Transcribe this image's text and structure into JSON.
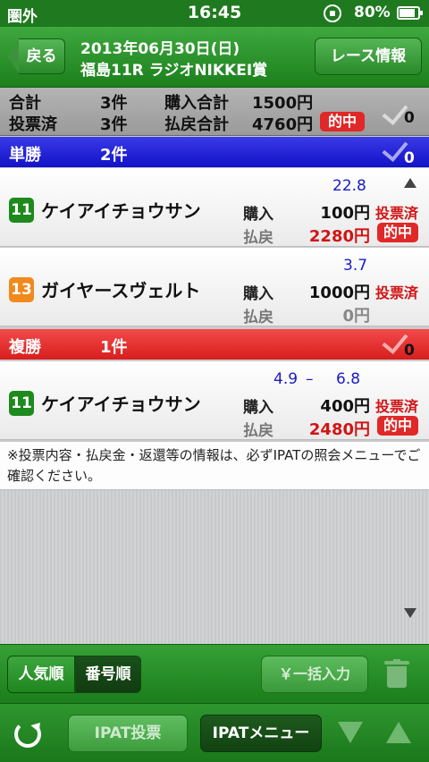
{
  "status_bar": {
    "carrier": "圏外",
    "time": "16:45",
    "battery": "80%"
  },
  "nav": {
    "back_label": "戻る",
    "date": "2013年06月30日(日)",
    "race": "福島11R ラジオNIKKEI賞",
    "race_info_label": "レース情報"
  },
  "summary": {
    "total_label": "合計",
    "total_count": "3件",
    "purchase_label": "購入合計",
    "purchase_amount": "1500円",
    "voted_label": "投票済",
    "voted_count": "3件",
    "payout_label": "払戻合計",
    "payout_amount": "4760円",
    "hit_badge": "的中",
    "checked_count": "0"
  },
  "sections": [
    {
      "name": "単勝",
      "count": "2件",
      "checked_count": "0",
      "color": "#1a1ad6"
    },
    {
      "name": "複勝",
      "count": "1件",
      "checked_count": "0",
      "color": "#e02a2a"
    }
  ],
  "bets": [
    {
      "number": "11",
      "number_color": "#1e8a1e",
      "horse": "ケイアイチョウサン",
      "odds": "22.8",
      "buy_label": "購入",
      "buy_amount": "100円",
      "status": "投票済",
      "payout_label": "払戻",
      "payout_amount": "2280円",
      "hit": "的中"
    },
    {
      "number": "13",
      "number_color": "#f08a1c",
      "horse": "ガイヤースヴェルト",
      "odds": "3.7",
      "buy_label": "購入",
      "buy_amount": "1000円",
      "status": "投票済",
      "payout_label": "払戻",
      "payout_amount": "0円"
    },
    {
      "number": "11",
      "number_color": "#1e8a1e",
      "horse": "ケイアイチョウサン",
      "odds_low": "4.9",
      "odds_sep": "–",
      "odds_high": "6.8",
      "buy_label": "購入",
      "buy_amount": "400円",
      "status": "投票済",
      "payout_label": "払戻",
      "payout_amount": "2480円",
      "hit": "的中"
    }
  ],
  "notice": "※投票内容・払戻金・返還等の情報は、必ずIPATの照会メニューでご確認ください。",
  "toolbar": {
    "sort_popular": "人気順",
    "sort_number": "番号順",
    "bulk_input": "￥一括入力",
    "ipat_vote": "IPAT投票",
    "ipat_menu": "IPATメニュー"
  },
  "icons": [
    "lock-rotation-icon",
    "battery-icon",
    "back-arrow-icon",
    "check-icon",
    "scroll-up-icon",
    "scroll-down-icon",
    "trash-icon",
    "refresh-icon",
    "arrow-down-icon",
    "arrow-up-icon"
  ]
}
